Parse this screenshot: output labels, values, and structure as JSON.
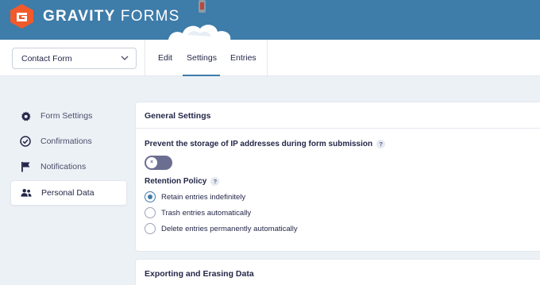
{
  "brand": {
    "name_bold": "GRAVITY",
    "name_light": " FORMS",
    "accent": "#3e7ca9"
  },
  "form_selector": {
    "value": "Contact Form",
    "icon": "chevron-down-icon"
  },
  "tabs": [
    {
      "label": "Edit"
    },
    {
      "label": "Settings",
      "active": true
    },
    {
      "label": "Entries"
    }
  ],
  "sidebar": {
    "items": [
      {
        "label": "Form Settings",
        "icon": "gear-icon"
      },
      {
        "label": "Confirmations",
        "icon": "check-circle-icon"
      },
      {
        "label": "Notifications",
        "icon": "flag-icon"
      },
      {
        "label": "Personal Data",
        "icon": "users-icon",
        "active": true
      }
    ]
  },
  "general_settings": {
    "title": "General Settings",
    "ip_label": "Prevent the storage of IP addresses during form submission",
    "ip_toggle": {
      "state": "off",
      "glyph": "×"
    },
    "help_glyph": "?",
    "retention": {
      "label": "Retention Policy",
      "options": [
        {
          "label": "Retain entries indefinitely",
          "checked": true
        },
        {
          "label": "Trash entries automatically",
          "checked": false
        },
        {
          "label": "Delete entries permanently automatically",
          "checked": false
        }
      ]
    }
  },
  "exporting": {
    "title": "Exporting and Erasing Data"
  }
}
